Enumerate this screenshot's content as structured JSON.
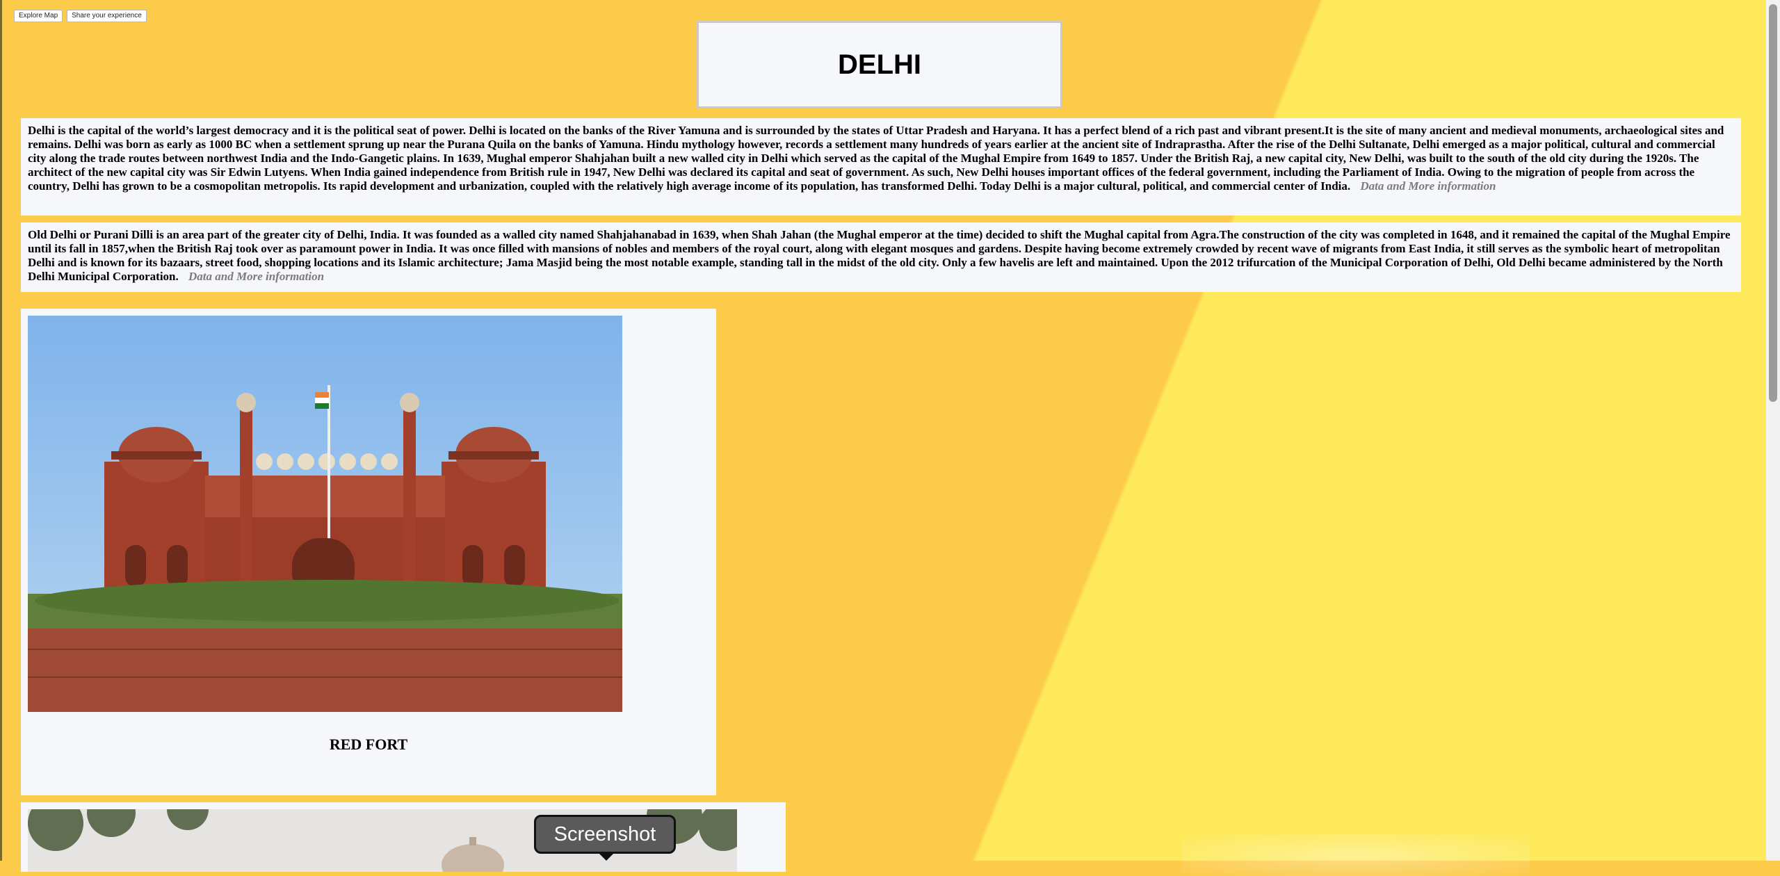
{
  "toolbar": {
    "explore_map": "Explore Map",
    "share_experience": "Share your experience"
  },
  "header": {
    "title": "DELHI"
  },
  "sections": [
    {
      "text": "Delhi is the capital of the world’s largest democracy and it is the political seat of power. Delhi is located on the banks of the River Yamuna and is surrounded by the states of Uttar Pradesh and Haryana. It has a perfect blend of a rich past and vibrant present.It is the site of many ancient and medieval monuments, archaeological sites and remains. Delhi was born as early as 1000 BC when a settlement sprung up near the Purana Quila on the banks of Yamuna. Hindu mythology however, records a settlement many hundreds of years earlier at the ancient site of Indraprastha. After the rise of the Delhi Sultanate, Delhi emerged as a major political, cultural and commercial city along the trade routes between northwest India and the Indo-Gangetic plains. In 1639, Mughal emperor Shahjahan built a new walled city in Delhi which served as the capital of the Mughal Empire from 1649 to 1857. Under the British Raj, a new capital city, New Delhi, was built to the south of the old city during the 1920s. The architect of the new capital city was Sir Edwin Lutyens. When India gained independence from British rule in 1947, New Delhi was declared its capital and seat of government. As such, New Delhi houses important offices of the federal government, including the Parliament of India. Owing to the migration of people from across the country, Delhi has grown to be a cosmopolitan metropolis. Its rapid development and urbanization, coupled with the relatively high average income of its population, has transformed Delhi. Today Delhi is a major cultural, political, and commercial center of India.",
      "more_link": "Data and More information"
    },
    {
      "text": "Old Delhi or Purani Dilli is an area part of the greater city of Delhi, India. It was founded as a walled city named Shahjahanabad in 1639, when Shah Jahan (the Mughal emperor at the time) decided to shift the Mughal capital from Agra.The construction of the city was completed in 1648, and it remained the capital of the Mughal Empire until its fall in 1857,when the British Raj took over as paramount power in India. It was once filled with mansions of nobles and members of the royal court, along with elegant mosques and gardens. Despite having become extremely crowded by recent wave of migrants from East India, it still serves as the symbolic heart of metropolitan Delhi and is known for its bazaars, street food, shopping locations and its Islamic architecture; Jama Masjid being the most notable example, standing tall in the midst of the old city. Only a few havelis are left and maintained. Upon the 2012 trifurcation of the Municipal Corporation of Delhi, Old Delhi became administered by the North Delhi Municipal Corporation.",
      "more_link": "Data and More information"
    }
  ],
  "cards": [
    {
      "caption": "RED FORT",
      "icon": "red-fort-photo"
    },
    {
      "caption": "",
      "icon": "monument-photo"
    }
  ],
  "tooltip": {
    "label": "Screenshot"
  },
  "colors": {
    "background": "#fccb4a",
    "background_light": "#fde95a",
    "panel": "#f6f7fb",
    "fort_red": "#a3402b",
    "sky": "#8fbfe8"
  }
}
